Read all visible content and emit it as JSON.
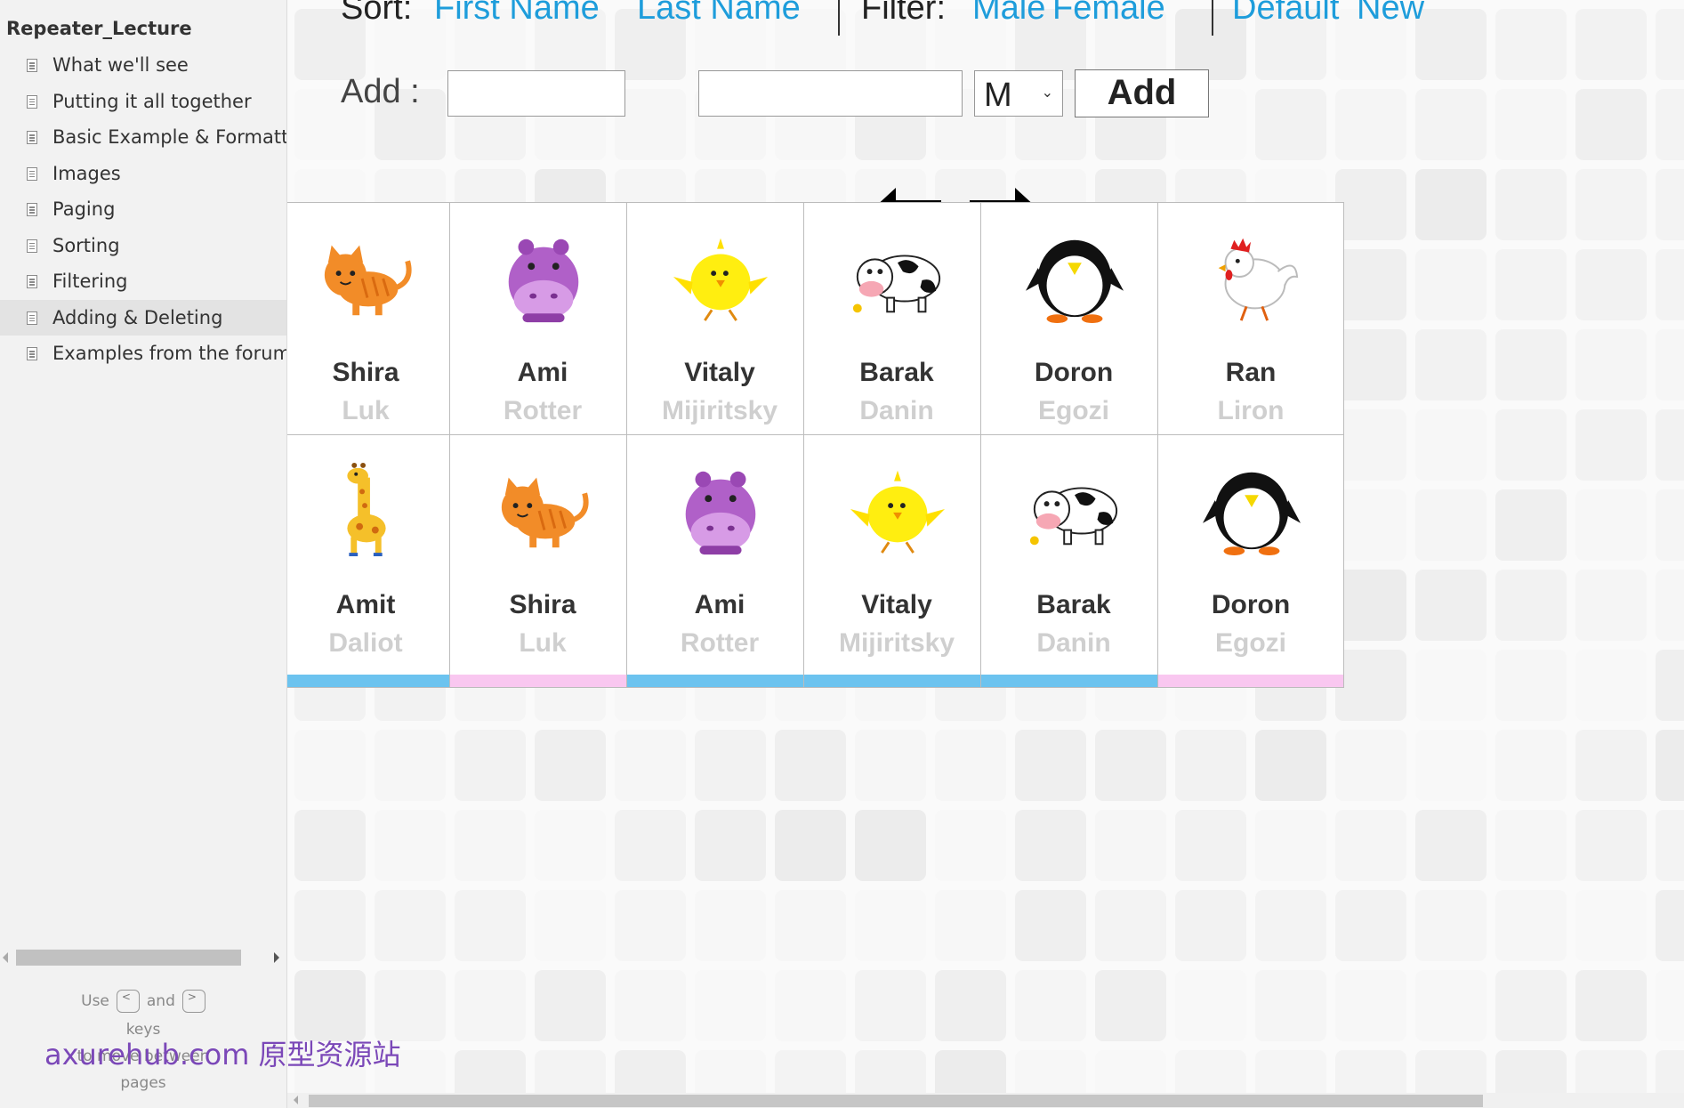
{
  "sidebar": {
    "project_title": "Repeater_Lecture",
    "pages": [
      {
        "label": "What we'll see"
      },
      {
        "label": "Putting it all together"
      },
      {
        "label": "Basic Example & Formatting"
      },
      {
        "label": "Images"
      },
      {
        "label": "Paging"
      },
      {
        "label": "Sorting"
      },
      {
        "label": "Filtering"
      },
      {
        "label": "Adding & Deleting",
        "selected": true
      },
      {
        "label": "Examples from the forums"
      }
    ],
    "hint": {
      "use": "Use",
      "prev_key": "<",
      "and": "and",
      "next_key": ">",
      "keys": "keys",
      "to_move_between": "to move between",
      "pages": "pages"
    }
  },
  "watermark": "axurehub.com 原型资源站",
  "toolbar": {
    "sort_label": "Sort:",
    "sort_first_name": "First Name",
    "sort_last_name": "Last Name",
    "filter_label": "Filter:",
    "filter_male": "Male",
    "filter_female": "Female",
    "default_label": "Default",
    "new_label": "New"
  },
  "add_form": {
    "label": "Add :",
    "first_name_value": "",
    "last_name_value": "",
    "gender_selected": "M",
    "add_button": "Add"
  },
  "colors": {
    "link": "#1e9ddb",
    "male_bar": "#6cc3ef",
    "female_bar": "#f9c7f0"
  },
  "cards": [
    {
      "first": "Shira",
      "last": "Luk",
      "gender": "F",
      "animal": "cat-icon"
    },
    {
      "first": "Ami",
      "last": "Rotter",
      "gender": "M",
      "animal": "hippo-icon"
    },
    {
      "first": "Vitaly",
      "last": "Mijiritsky",
      "gender": "M",
      "animal": "chick-icon"
    },
    {
      "first": "Barak",
      "last": "Danin",
      "gender": "M",
      "animal": "cow-icon"
    },
    {
      "first": "Doron",
      "last": "Egozi",
      "gender": "F",
      "animal": "penguin-icon"
    },
    {
      "first": "Ran",
      "last": "Liron",
      "gender": "M",
      "animal": "rooster-icon"
    },
    {
      "first": "Amit",
      "last": "Daliot",
      "gender": "M",
      "animal": "giraffe-icon"
    },
    {
      "first": "Shira",
      "last": "Luk",
      "gender": "F",
      "animal": "cat-icon"
    },
    {
      "first": "Ami",
      "last": "Rotter",
      "gender": "M",
      "animal": "hippo-icon"
    },
    {
      "first": "Vitaly",
      "last": "Mijiritsky",
      "gender": "M",
      "animal": "chick-icon"
    },
    {
      "first": "Barak",
      "last": "Danin",
      "gender": "M",
      "animal": "cow-icon"
    },
    {
      "first": "Doron",
      "last": "Egozi",
      "gender": "F",
      "animal": "penguin-icon"
    }
  ]
}
